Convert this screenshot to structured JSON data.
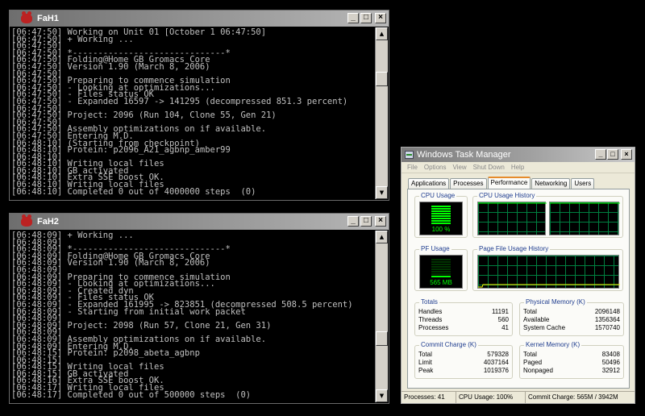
{
  "console1": {
    "title": "FaH1",
    "lines": [
      "[06:47:50] Working on Unit 01 [October 1 06:47:50]",
      "[06:47:50] + Working ...",
      "[06:47:50]",
      "[06:47:50] *------------------------------*",
      "[06:47:50] Folding@Home GB Gromacs Core",
      "[06:47:50] Version 1.90 (March 8, 2006)",
      "[06:47:50]",
      "[06:47:50] Preparing to commence simulation",
      "[06:47:50] - Looking at optimizations...",
      "[06:47:50] - Files status OK",
      "[06:47:50] - Expanded 16597 -> 141295 (decompressed 851.3 percent)",
      "[06:47:50]",
      "[06:47:50] Project: 2096 (Run 104, Clone 55, Gen 21)",
      "[06:47:50]",
      "[06:47:50] Assembly optimizations on if available.",
      "[06:47:50] Entering M.D.",
      "[06:48:10] (Starting from checkpoint)",
      "[06:48:10] Protein: p2096_A21_agbnp_amber99",
      "[06:48:10]",
      "[06:48:10] Writing local files",
      "[06:48:10] GB activated",
      "[06:48:10] Extra SSE boost OK.",
      "[06:48:10] Writing local files",
      "[06:48:10] Completed 0 out of 4000000 steps  (0)"
    ]
  },
  "console2": {
    "title": "FaH2",
    "lines": [
      "[06:48:09] + Working ...",
      "[06:48:09]",
      "[06:48:09] *------------------------------*",
      "[06:48:09] Folding@Home GB Gromacs Core",
      "[06:48:09] Version 1.90 (March 8, 2006)",
      "[06:48:09]",
      "[06:48:09] Preparing to commence simulation",
      "[06:48:09] - Looking at optimizations...",
      "[06:48:09] - Created dyn",
      "[06:48:09] - Files status OK",
      "[06:48:09] - Expanded 161995 -> 823851 (decompressed 508.5 percent)",
      "[06:48:09] - Starting from initial work packet",
      "[06:48:09]",
      "[06:48:09] Project: 2098 (Run 57, Clone 21, Gen 31)",
      "[06:48:09]",
      "[06:48:09] Assembly optimizations on if available.",
      "[06:48:09] Entering M.D.",
      "[06:48:15] Protein: p2098_abeta_agbnp",
      "[06:48:15]",
      "[06:48:15] Writing local files",
      "[06:48:15] GB activated",
      "[06:48:16] Extra SSE boost OK.",
      "[06:48:17] Writing local files",
      "[06:48:17] Completed 0 out of 500000 steps  (0)"
    ]
  },
  "window_buttons": {
    "minimize": "_",
    "maximize": "□",
    "close": "×"
  },
  "scroll_arrows": {
    "up": "▲",
    "down": "▼"
  },
  "taskmgr": {
    "title": "Windows Task Manager",
    "menu": [
      "File",
      "Options",
      "View",
      "Shut Down",
      "Help"
    ],
    "tabs": [
      "Applications",
      "Processes",
      "Performance",
      "Networking",
      "Users"
    ],
    "active_tab": "Performance",
    "cpu_usage_label": "CPU Usage",
    "cpu_usage_value": "100 %",
    "cpu_usage_level": 1.0,
    "cpu_history_label": "CPU Usage History",
    "pf_usage_label": "PF Usage",
    "pf_usage_value": "565 MB",
    "pf_usage_level": 0.14,
    "pf_history_label": "Page File Usage History",
    "totals": {
      "label": "Totals",
      "rows": [
        {
          "name": "Handles",
          "value": "11191"
        },
        {
          "name": "Threads",
          "value": "560"
        },
        {
          "name": "Processes",
          "value": "41"
        }
      ]
    },
    "physical": {
      "label": "Physical Memory (K)",
      "rows": [
        {
          "name": "Total",
          "value": "2096148"
        },
        {
          "name": "Available",
          "value": "1356364"
        },
        {
          "name": "System Cache",
          "value": "1570740"
        }
      ]
    },
    "commit": {
      "label": "Commit Charge (K)",
      "rows": [
        {
          "name": "Total",
          "value": "579328"
        },
        {
          "name": "Limit",
          "value": "4037164"
        },
        {
          "name": "Peak",
          "value": "1019376"
        }
      ]
    },
    "kernel": {
      "label": "Kernel Memory (K)",
      "rows": [
        {
          "name": "Total",
          "value": "83408"
        },
        {
          "name": "Paged",
          "value": "50496"
        },
        {
          "name": "Nonpaged",
          "value": "32912"
        }
      ]
    },
    "status": {
      "processes": "Processes: 41",
      "cpu": "CPU Usage: 100%",
      "commit": "Commit Charge: 565M / 3942M"
    },
    "colors": {
      "graph_line": "#00ff00",
      "grid": "#008040",
      "pf_line": "#ffff00"
    }
  }
}
